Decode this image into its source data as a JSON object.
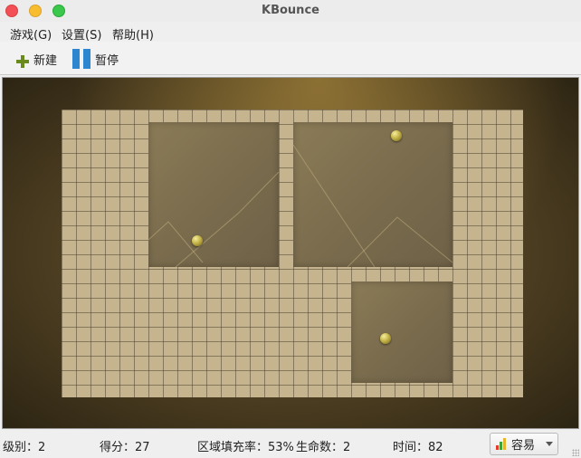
{
  "window": {
    "title": "KBounce"
  },
  "menubar": {
    "items": [
      "游戏(G)",
      "设置(S)",
      "帮助(H)"
    ]
  },
  "toolbar": {
    "new_label": "新建",
    "pause_label": "暂停"
  },
  "status": {
    "level": "级别：2",
    "score": "得分：27",
    "fill": "区域填充率：53%",
    "lives": "生命数：2",
    "time": "时间：82",
    "difficulty": "容易"
  },
  "colors": {
    "bar_red": "#e23b2e",
    "bar_green": "#3aa43a",
    "bar_yellow": "#e7b52b",
    "pause_blue": "#2d86cf",
    "plus_green": "#6a8a1e"
  }
}
